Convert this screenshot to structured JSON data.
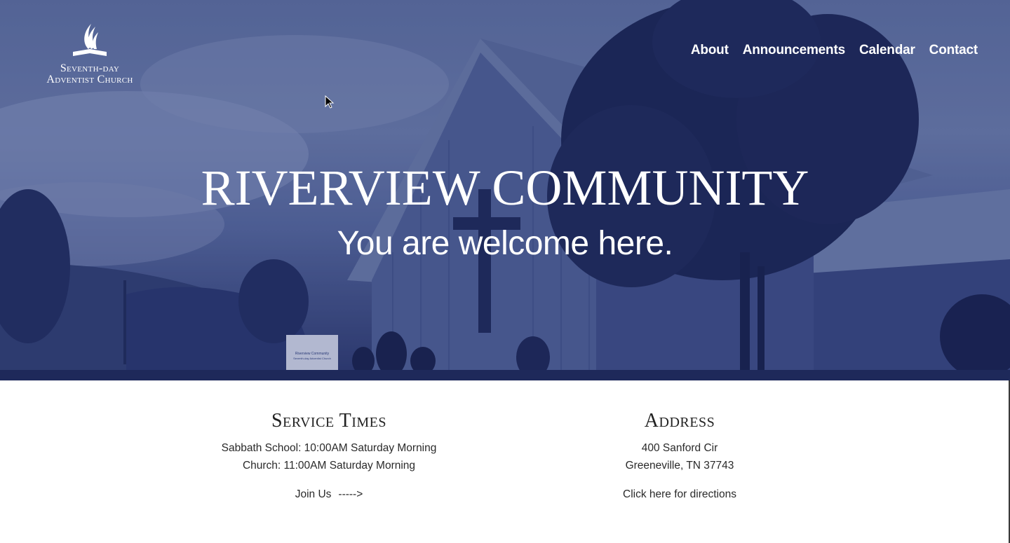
{
  "logo": {
    "line1": "Seventh-day",
    "line2": "Adventist Church"
  },
  "nav": {
    "items": [
      {
        "label": "About"
      },
      {
        "label": "Announcements"
      },
      {
        "label": "Calendar"
      },
      {
        "label": "Contact"
      }
    ]
  },
  "hero": {
    "title": "RIVERVIEW COMMUNITY",
    "subtitle": "You are welcome here.",
    "sign_line1": "Riverview Community",
    "sign_line2": "Seventh-day Adventist Church"
  },
  "service": {
    "heading": "Service Times",
    "line1": "Sabbath School: 10:00AM Saturday Morning",
    "line2": "Church: 11:00AM Saturday Morning",
    "cta_label": "Join Us",
    "cta_arrow": "----->"
  },
  "address": {
    "heading": "Address",
    "street": "400 Sanford Cir",
    "city": "Greeneville, TN 37743",
    "directions_label": "Click here for directions"
  },
  "colors": {
    "overlay": "#2b3a78",
    "text_dark": "#2a2a2a",
    "white": "#ffffff"
  }
}
